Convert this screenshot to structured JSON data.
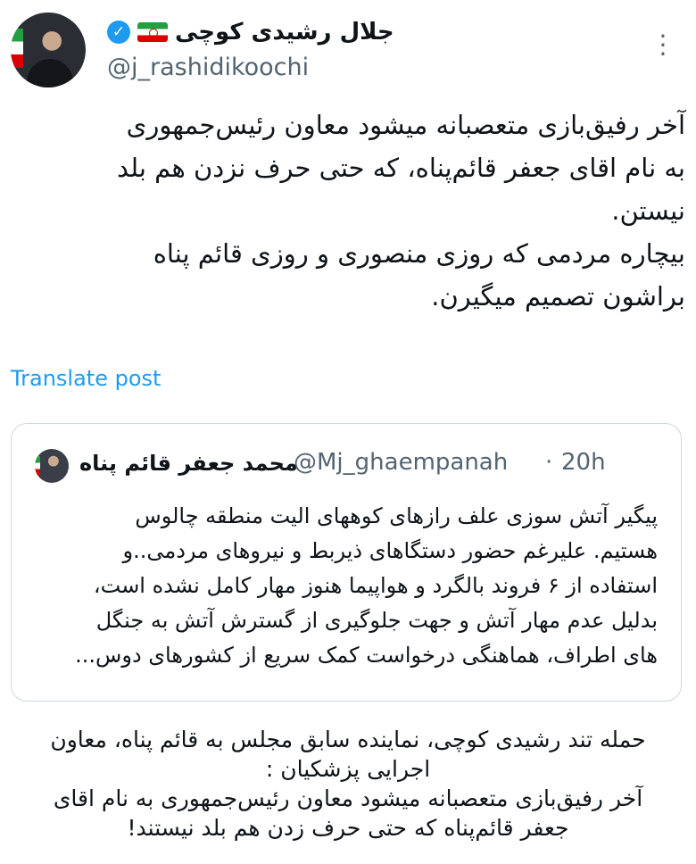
{
  "tweet": {
    "display_name": "جلال رشیدی کوچی",
    "handle": "@j_rashidikoochi",
    "icons": {
      "verified": "verified-badge-icon",
      "flag": "iran-flag-icon",
      "more": "more-options-icon"
    },
    "text": "آخر رفیق‌بازی متعصبانه میشود معاون رئیس‌جمهوری\nبه نام اقای جعفر قائم‌پناه، که حتی حرف نزدن هم بلد\nنیستن.\nبیچاره مردمی که روزی منصوری و روزی قائم پناه\nبراشون تصمیم میگیرن.",
    "translate_label": "Translate post"
  },
  "quote": {
    "display_name": "محمد جعفر قائم پناه",
    "handle": "@Mj_ghaempanah",
    "separator": "·",
    "time": "20h",
    "text": "پیگیر آتش سوزی علف رازهای کوههای الیت منطقه چالوس\nهستیم. علیرغم حضور دستگاهای ذیربط و نیروهای مردمی..و\nاستفاده از ۶ فروند بالگرد و هواپیما هنوز مهار کامل نشده است،\nبدلیل عدم مهار آتش و جهت جلوگیری از گسترش آتش به جنگل\nهای اطراف، هماهنگی درخواست کمک سریع از کشورهای دوس..."
  },
  "caption": {
    "text": "حمله تند رشیدی کوچی، نماینده سابق مجلس به قائم پناه، معاون\nاجرایی پزشکیان :\nآخر رفیق‌بازی متعصبانه میشود معاون رئیس‌جمهوری به نام اقای\nجعفر قائم‌پناه که حتی حرف زدن هم بلد نیستند!"
  },
  "colors": {
    "link": "#1d9bf0",
    "secondary": "#536471",
    "border": "#cfd9de",
    "text": "#0f1419"
  }
}
